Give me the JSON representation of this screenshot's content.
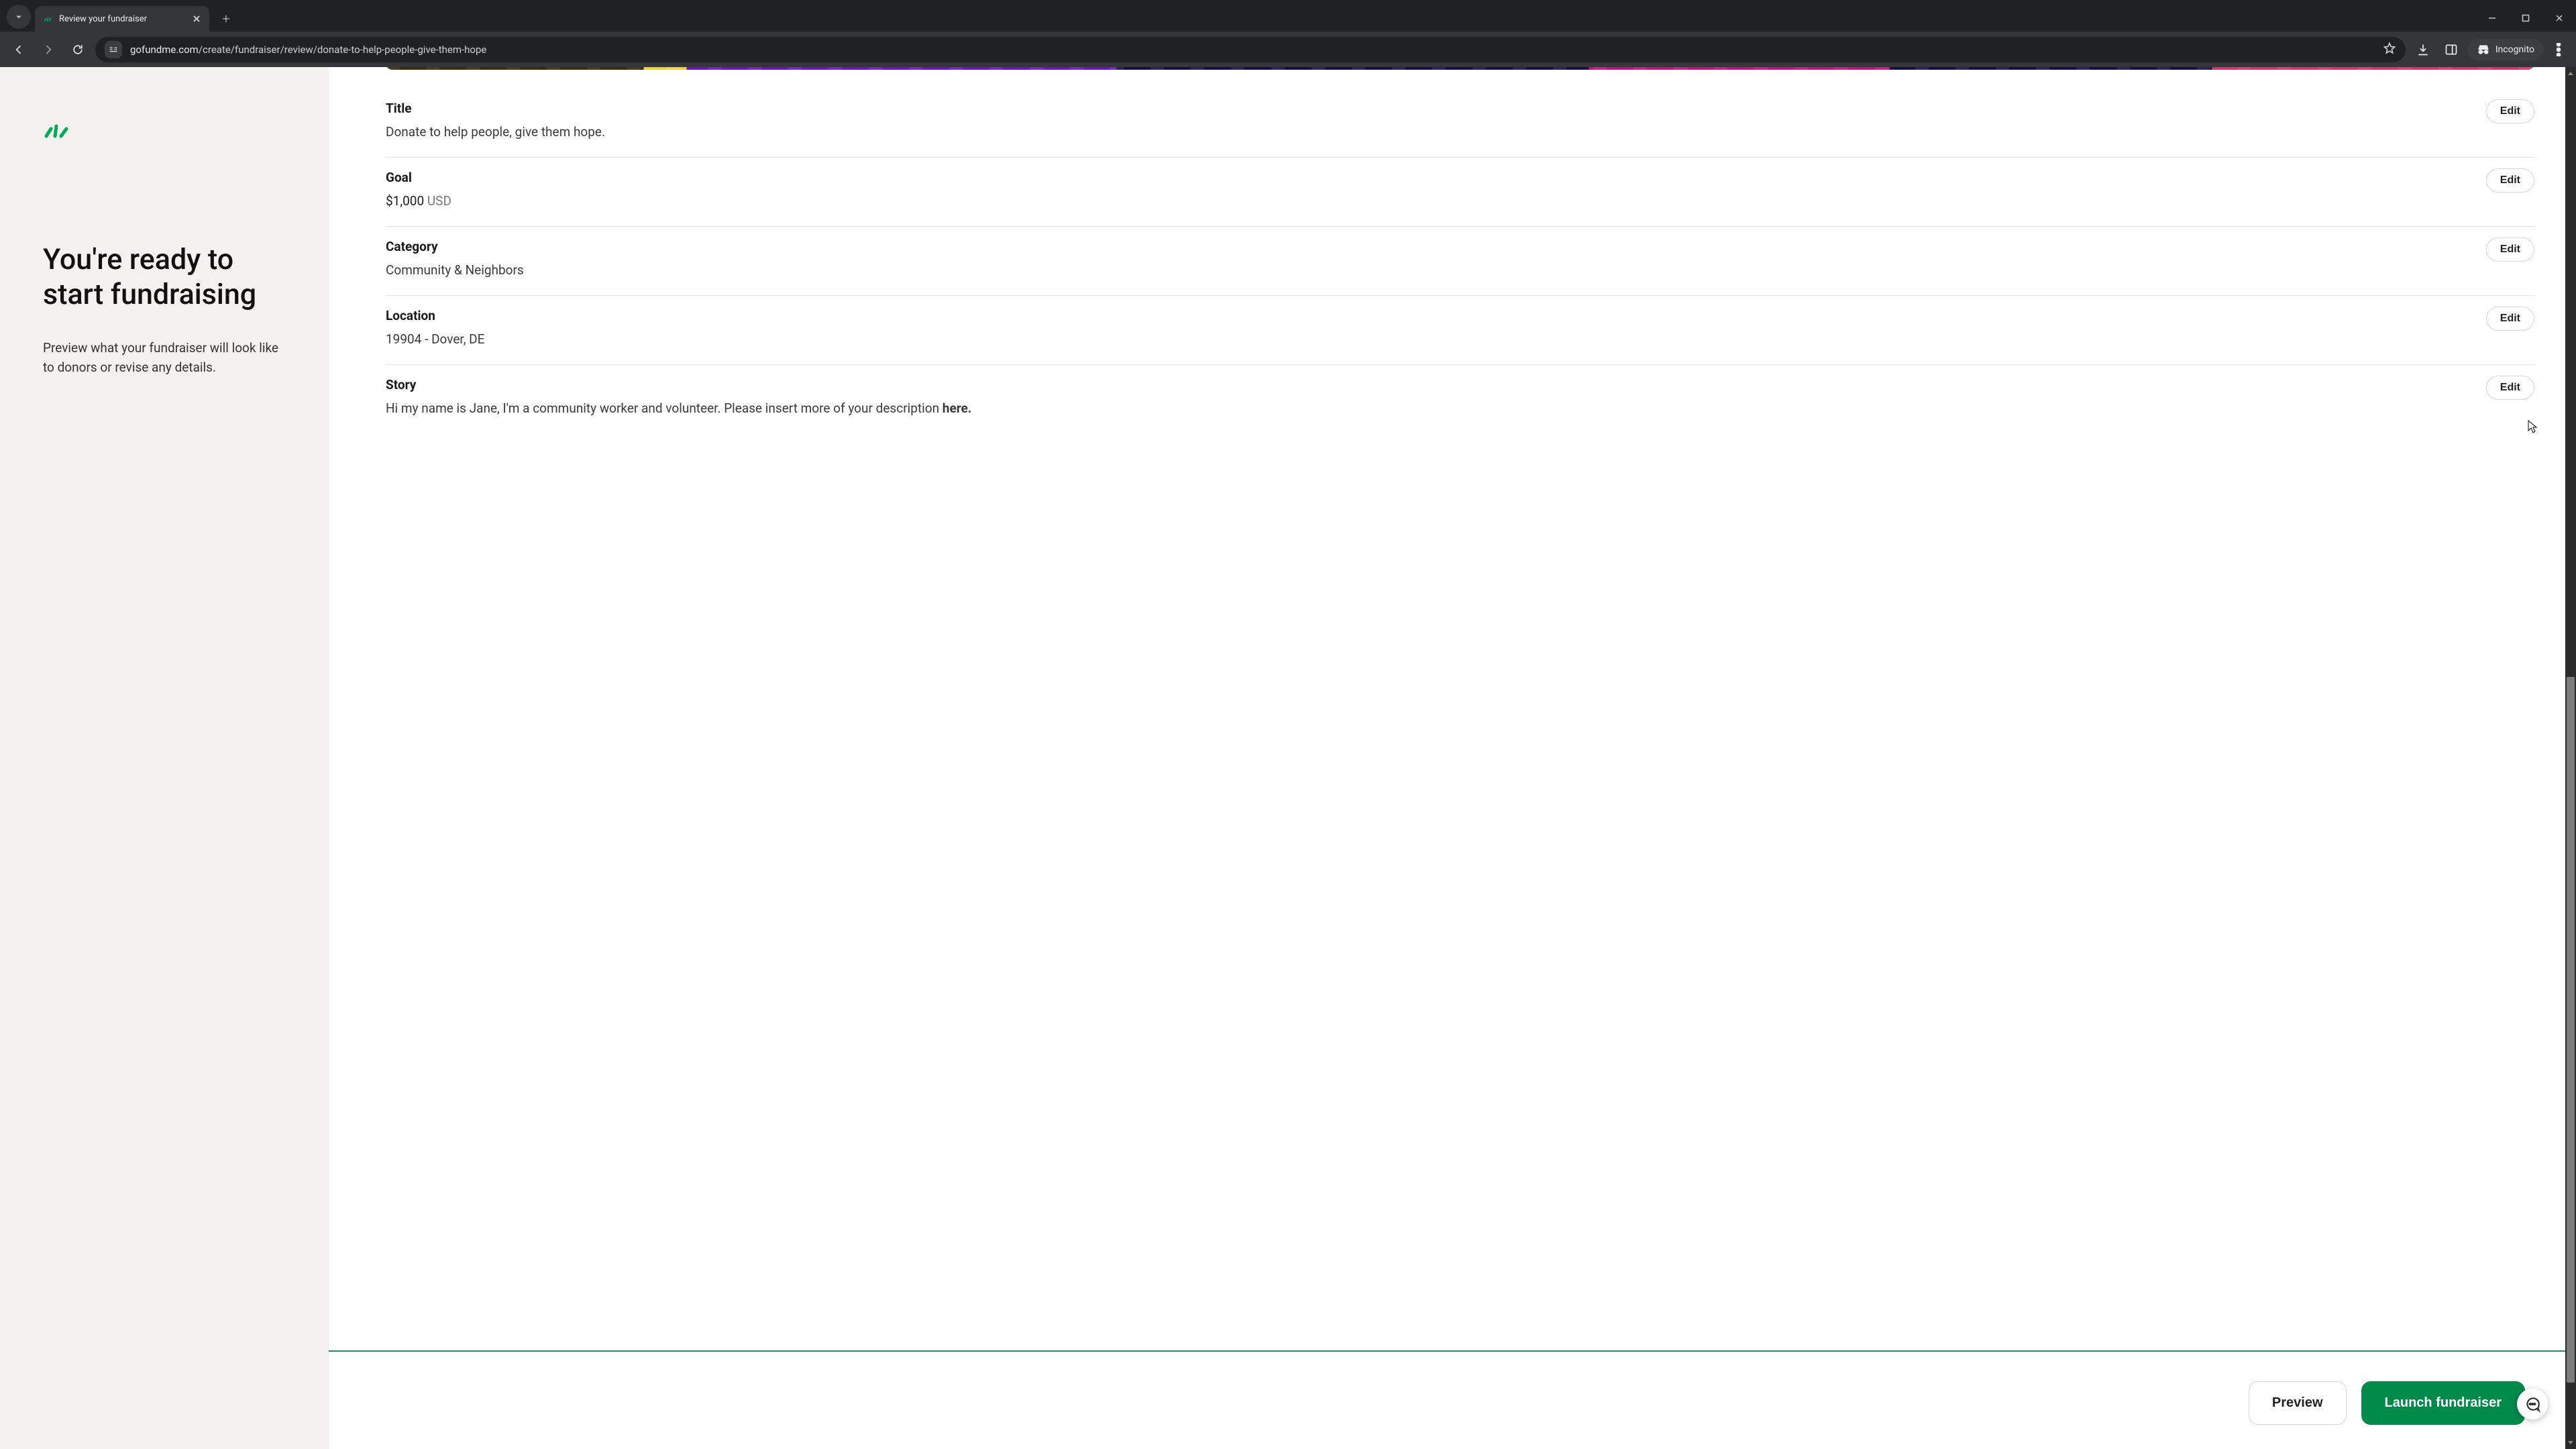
{
  "browser": {
    "tab_title": "Review your fundraiser",
    "url_domain": "gofundme.com",
    "url_path": "/create/fundraiser/review/donate-to-help-people-give-them-hope",
    "incognito_label": "Incognito"
  },
  "left": {
    "headline": "You're ready to start fundraising",
    "subtext": "Preview what your fundraiser will look like to donors or revise any details."
  },
  "review": {
    "edit_label": "Edit",
    "title": {
      "label": "Title",
      "value": "Donate to help people, give them hope."
    },
    "goal": {
      "label": "Goal",
      "amount": "$1,000",
      "currency": "USD"
    },
    "category": {
      "label": "Category",
      "value": "Community & Neighbors"
    },
    "location": {
      "label": "Location",
      "value": "19904 - Dover, DE"
    },
    "story": {
      "label": "Story",
      "text_prefix": "Hi my name is Jane, I'm a community worker and volunteer. Please insert more of your description ",
      "text_bold": "here."
    }
  },
  "footer": {
    "preview": "Preview",
    "launch": "Launch fundraiser"
  }
}
